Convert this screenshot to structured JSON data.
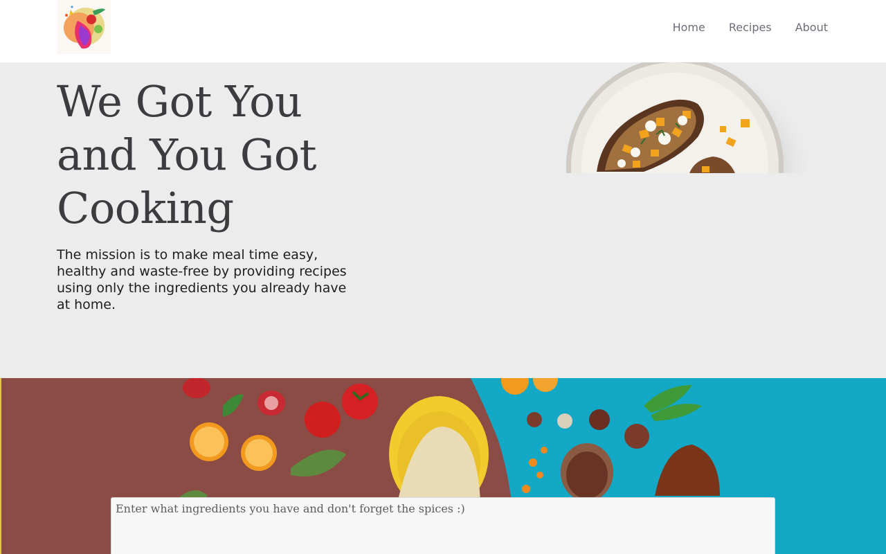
{
  "header": {
    "logo_icon": "fruit-logo-icon",
    "nav": [
      {
        "label": "Home"
      },
      {
        "label": "Recipes"
      },
      {
        "label": "About"
      }
    ]
  },
  "hero": {
    "title": "We Got You and You Got Cooking",
    "description": "The mission is to make meal time easy, healthy and waste-free by providing recipes using only the ingredients you already have at home."
  },
  "ingredients": {
    "placeholder": "Enter what ingredients you have and don't forget the spices :)",
    "value": ""
  },
  "colors": {
    "hero_bg": "#ececec",
    "banner_brown": "#8a4c44",
    "banner_teal": "#13a8c6",
    "nav_text": "#6d6e78",
    "title_text": "#3b3b40"
  }
}
